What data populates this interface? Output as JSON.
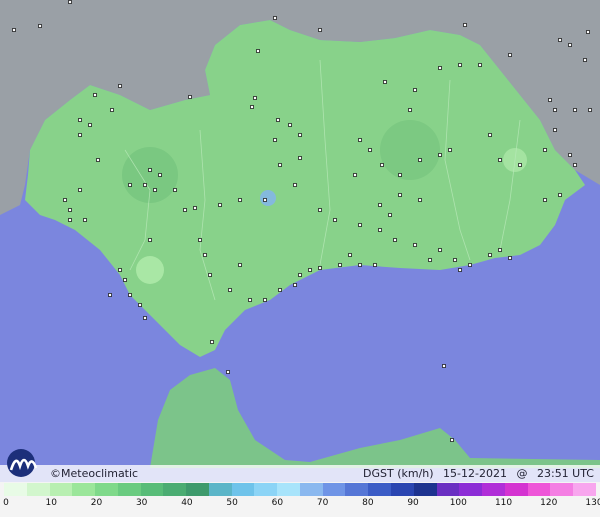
{
  "brand": {
    "name": "©Meteoclimatic"
  },
  "caption": {
    "variable": "DGST (km/h)",
    "date": "15-12-2021",
    "at": "@",
    "time": "23:51 UTC"
  },
  "legend": {
    "labels": [
      "0",
      "10",
      "20",
      "30",
      "40",
      "50",
      "60",
      "70",
      "80",
      "90",
      "100",
      "110",
      "120",
      "130"
    ],
    "colors": [
      "#e8fbe6",
      "#d2f6cd",
      "#b8efb1",
      "#9be69a",
      "#7fd98a",
      "#6acb80",
      "#58bc78",
      "#4bac72",
      "#3e9a6c",
      "#5bb5c8",
      "#6fc3ea",
      "#8cd4f6",
      "#a8e4fb",
      "#8ab8ef",
      "#6f94e6",
      "#5576d6",
      "#3b5cc6",
      "#2a45b1",
      "#1d338f",
      "#6a2fc2",
      "#8c2cd6",
      "#b02ed8",
      "#d433d1",
      "#ee55d8",
      "#f47ee3",
      "#f8a6ee"
    ]
  },
  "colors": {
    "sea": "#7b86de",
    "land_main": "#88d28a",
    "land_other": "#9aa0a6",
    "station": "#ffffff"
  }
}
